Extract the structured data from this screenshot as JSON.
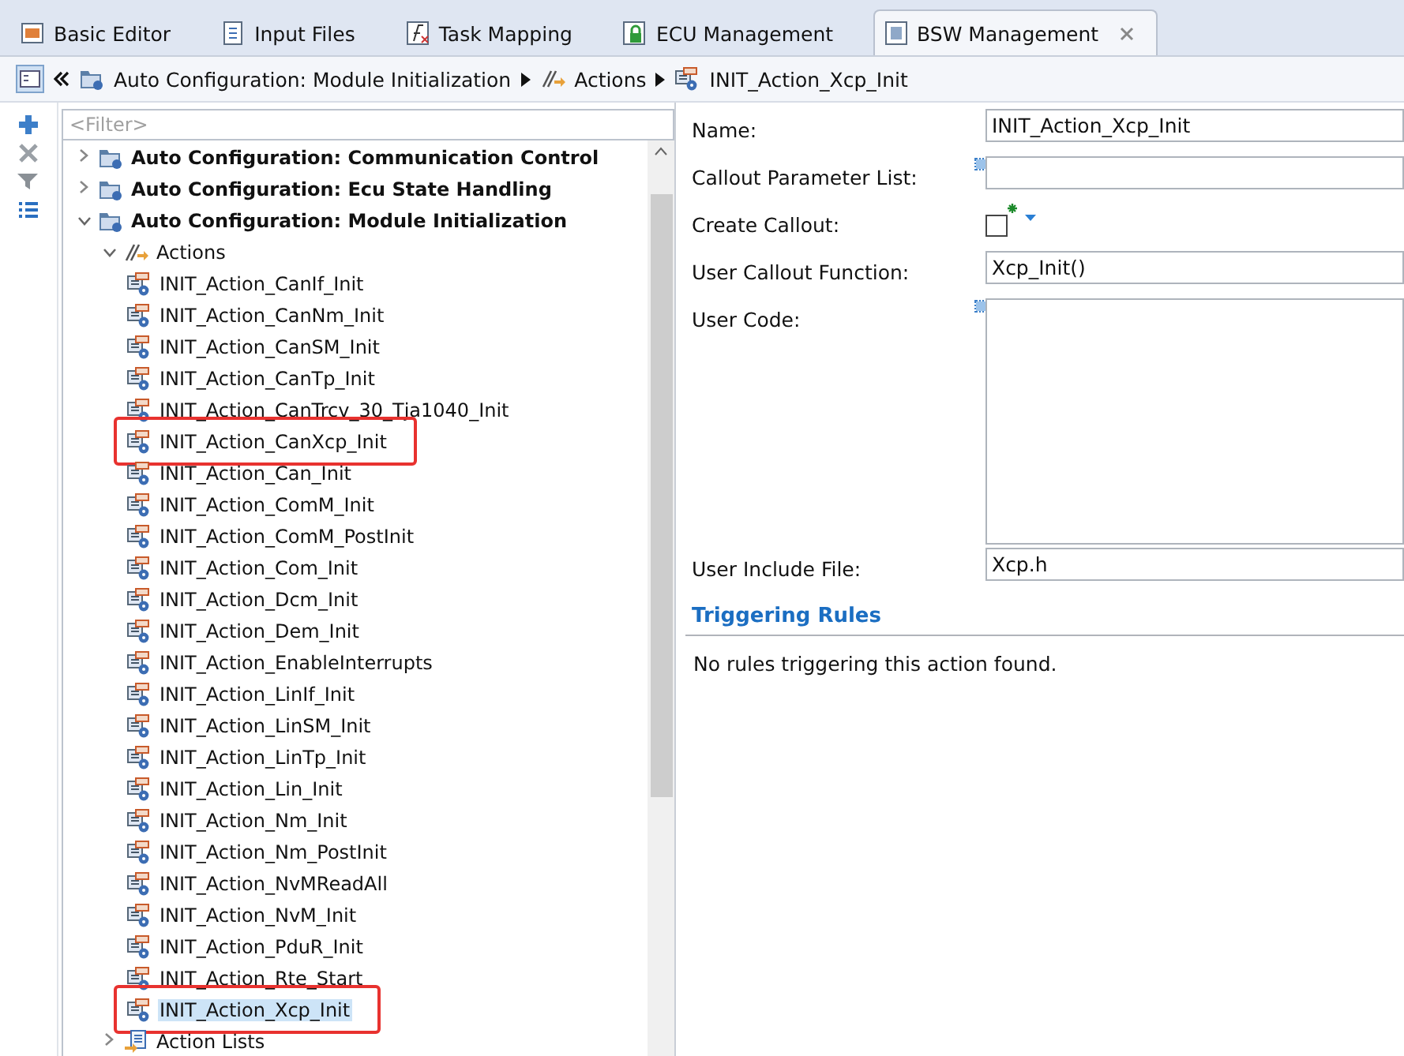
{
  "tabs": [
    {
      "label": "Basic Editor",
      "selected": false,
      "closable": false
    },
    {
      "label": "Input Files",
      "selected": false,
      "closable": false
    },
    {
      "label": "Task Mapping",
      "selected": false,
      "closable": false
    },
    {
      "label": "ECU Management",
      "selected": false,
      "closable": false
    },
    {
      "label": "BSW Management",
      "selected": true,
      "closable": true
    }
  ],
  "breadcrumb": [
    {
      "label": "Auto Configuration: Module Initialization",
      "kind": "folder"
    },
    {
      "label": "Actions",
      "kind": "actions"
    },
    {
      "label": "INIT_Action_Xcp_Init",
      "kind": "action"
    }
  ],
  "filter": {
    "placeholder": "<Filter>"
  },
  "tree": [
    {
      "label": "Auto Configuration: Communication Control",
      "kind": "folder",
      "expanded": false
    },
    {
      "label": "Auto Configuration: Ecu State Handling",
      "kind": "folder",
      "expanded": false
    },
    {
      "label": "Auto Configuration: Module Initialization",
      "kind": "folder",
      "expanded": true,
      "children": [
        {
          "label": "Actions",
          "kind": "actions",
          "expanded": true,
          "children": [
            {
              "label": "INIT_Action_CanIf_Init",
              "kind": "action",
              "selected": false,
              "marked": false
            },
            {
              "label": "INIT_Action_CanNm_Init",
              "kind": "action",
              "selected": false,
              "marked": false
            },
            {
              "label": "INIT_Action_CanSM_Init",
              "kind": "action",
              "selected": false,
              "marked": false
            },
            {
              "label": "INIT_Action_CanTp_Init",
              "kind": "action",
              "selected": false,
              "marked": false
            },
            {
              "label": "INIT_Action_CanTrcv_30_Tja1040_Init",
              "kind": "action",
              "selected": false,
              "marked": false
            },
            {
              "label": "INIT_Action_CanXcp_Init",
              "kind": "action",
              "selected": false,
              "marked": true
            },
            {
              "label": "INIT_Action_Can_Init",
              "kind": "action",
              "selected": false,
              "marked": false
            },
            {
              "label": "INIT_Action_ComM_Init",
              "kind": "action",
              "selected": false,
              "marked": false
            },
            {
              "label": "INIT_Action_ComM_PostInit",
              "kind": "action",
              "selected": false,
              "marked": false
            },
            {
              "label": "INIT_Action_Com_Init",
              "kind": "action",
              "selected": false,
              "marked": false
            },
            {
              "label": "INIT_Action_Dcm_Init",
              "kind": "action",
              "selected": false,
              "marked": false
            },
            {
              "label": "INIT_Action_Dem_Init",
              "kind": "action",
              "selected": false,
              "marked": false
            },
            {
              "label": "INIT_Action_EnableInterrupts",
              "kind": "action",
              "selected": false,
              "marked": false
            },
            {
              "label": "INIT_Action_LinIf_Init",
              "kind": "action",
              "selected": false,
              "marked": false
            },
            {
              "label": "INIT_Action_LinSM_Init",
              "kind": "action",
              "selected": false,
              "marked": false
            },
            {
              "label": "INIT_Action_LinTp_Init",
              "kind": "action",
              "selected": false,
              "marked": false
            },
            {
              "label": "INIT_Action_Lin_Init",
              "kind": "action",
              "selected": false,
              "marked": false
            },
            {
              "label": "INIT_Action_Nm_Init",
              "kind": "action",
              "selected": false,
              "marked": false
            },
            {
              "label": "INIT_Action_Nm_PostInit",
              "kind": "action",
              "selected": false,
              "marked": false
            },
            {
              "label": "INIT_Action_NvMReadAll",
              "kind": "action",
              "selected": false,
              "marked": false
            },
            {
              "label": "INIT_Action_NvM_Init",
              "kind": "action",
              "selected": false,
              "marked": false
            },
            {
              "label": "INIT_Action_PduR_Init",
              "kind": "action",
              "selected": false,
              "marked": false
            },
            {
              "label": "INIT_Action_Rte_Start",
              "kind": "action",
              "selected": false,
              "marked": false
            },
            {
              "label": "INIT_Action_Xcp_Init",
              "kind": "action",
              "selected": true,
              "marked": true
            }
          ]
        },
        {
          "label": "Action Lists",
          "kind": "action-list",
          "expanded": false
        }
      ]
    }
  ],
  "form": [
    {
      "label": "Name:",
      "kind": "text",
      "value": "INIT_Action_Xcp_Init",
      "assist": false
    },
    {
      "label": "Callout Parameter List:",
      "kind": "text",
      "assist": true
    },
    {
      "label": "Create Callout:",
      "kind": "checkbox",
      "checked": false
    },
    {
      "label": "User Callout Function:",
      "kind": "text",
      "value": "Xcp_Init()",
      "assist": false
    },
    {
      "label": "User Code:",
      "kind": "textarea",
      "assist": true
    },
    {
      "label": "User Include File:",
      "kind": "text",
      "value": "Xcp.h",
      "assist": false
    }
  ],
  "triggering": {
    "title": "Triggering Rules",
    "message": "No rules triggering this action found."
  }
}
